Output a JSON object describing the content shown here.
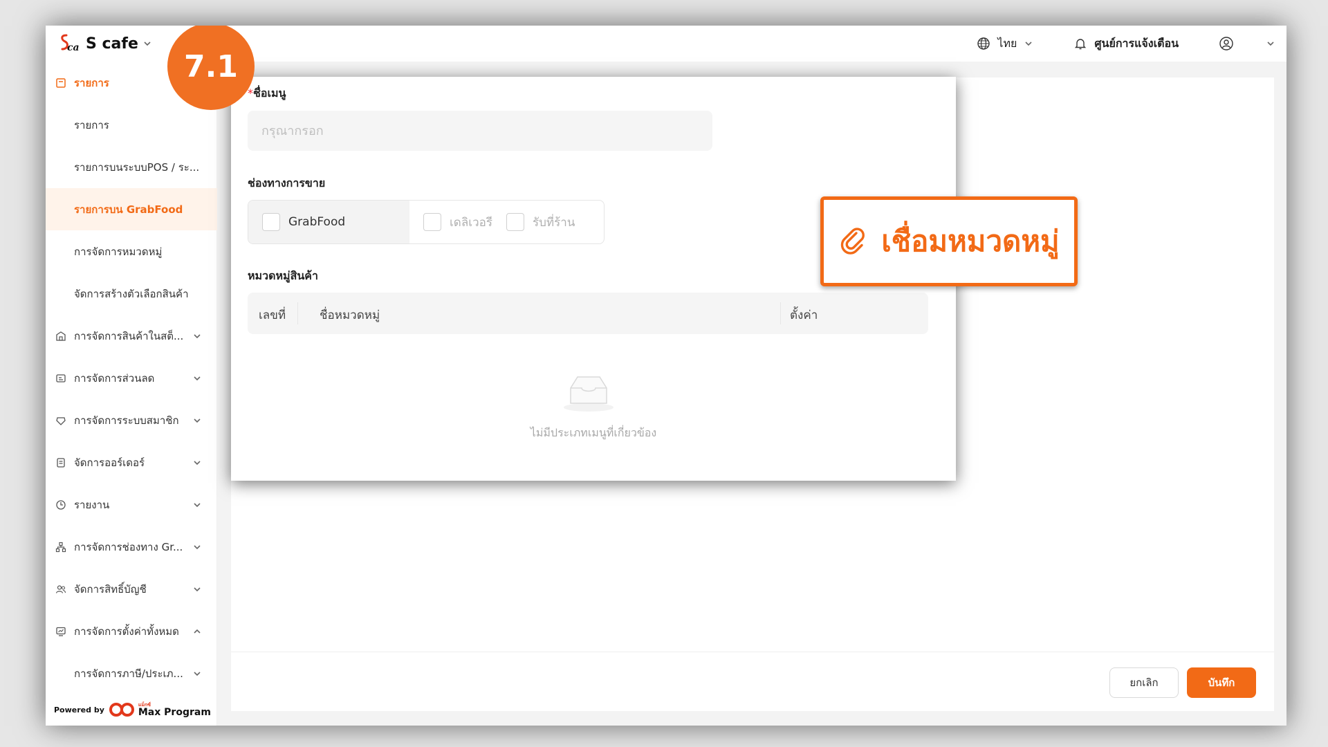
{
  "header": {
    "app_name": "S cafe",
    "language": "ไทย",
    "notification_center": "ศูนย์การแจ้งเตือน"
  },
  "step_badge": "7.1",
  "sidebar": {
    "items": [
      {
        "label": "รายการ",
        "icon": "list-icon"
      },
      {
        "label": "รายการ"
      },
      {
        "label": "รายการบนระบบPOS / ระ..."
      },
      {
        "label": "รายการบน GrabFood"
      },
      {
        "label": "การจัดการหมวดหมู่"
      },
      {
        "label": "จัดการสร้างตัวเลือกสินค้า"
      },
      {
        "label": "การจัดการสินค้าในสต็...",
        "icon": "store-icon"
      },
      {
        "label": "การจัดการส่วนลด",
        "icon": "discount-icon"
      },
      {
        "label": "การจัดการระบบสมาชิก",
        "icon": "member-icon"
      },
      {
        "label": "จัดการออร์เดอร์",
        "icon": "order-icon"
      },
      {
        "label": "รายงาน",
        "icon": "report-icon"
      },
      {
        "label": "การจัดการช่องทาง Gr...",
        "icon": "channel-icon"
      },
      {
        "label": "จัดการสิทธิ์บัญชี",
        "icon": "account-icon"
      },
      {
        "label": "การจัดการตั้งค่าทั้งหมด",
        "icon": "settings-icon"
      },
      {
        "label": "การจัดการภาษี/ประเภ..."
      }
    ],
    "powered_by": "Powered by",
    "brand": "Max Program",
    "brand_small": "แม็กซ์"
  },
  "form": {
    "menu_name_label": "ชื่อเมนู",
    "menu_name_required_mark": "*",
    "menu_name_placeholder": "กรุณากรอก",
    "menu_name_value": "",
    "channels_label": "ช่องทางการขาย",
    "channels": [
      {
        "label": "GrabFood",
        "checked": false,
        "enabled": true
      },
      {
        "label": "เดลิเวอรี",
        "checked": false,
        "enabled": false
      },
      {
        "label": "รับที่ร้าน",
        "checked": false,
        "enabled": false
      }
    ],
    "category_label": "หมวดหมู่สินค้า",
    "table_headers": [
      "เลขที่",
      "ชื่อหมวดหมู่",
      "ตั้งค่า"
    ],
    "empty_text": "ไม่มีประเภทเมนูที่เกี่ยวข้อง"
  },
  "callout": {
    "label": "เชื่อมหมวดหมู่",
    "icon": "link-icon"
  },
  "footer": {
    "cancel": "ยกเลิก",
    "save": "บันทึก"
  },
  "colors": {
    "accent": "#f26a16",
    "badge": "#f07023"
  }
}
